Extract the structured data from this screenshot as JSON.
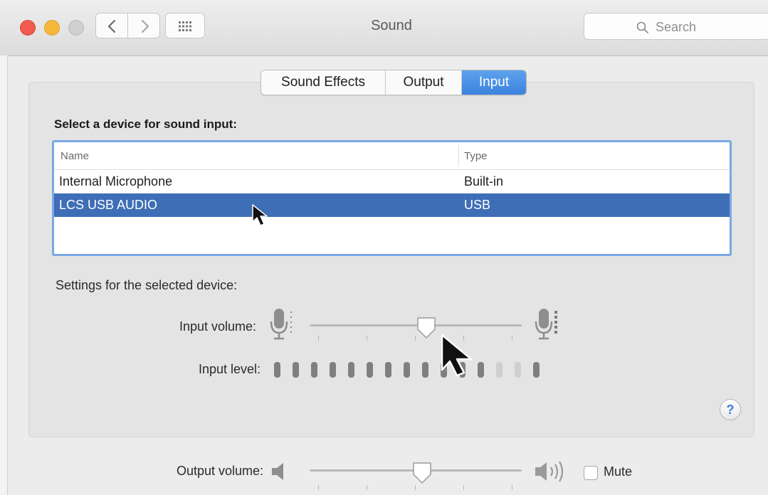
{
  "window": {
    "title": "Sound",
    "search_placeholder": "Search"
  },
  "tabs": [
    {
      "label": "Sound Effects",
      "selected": false
    },
    {
      "label": "Output",
      "selected": false
    },
    {
      "label": "Input",
      "selected": true
    }
  ],
  "input_panel": {
    "heading": "Select a device for sound input:",
    "columns": [
      "Name",
      "Type"
    ],
    "devices": [
      {
        "name": "Internal Microphone",
        "type": "Built-in",
        "selected": false
      },
      {
        "name": "LCS USB AUDIO",
        "type": "USB",
        "selected": true
      }
    ],
    "settings_heading": "Settings for the selected device:",
    "input_volume_label": "Input volume:",
    "input_volume_fraction": 0.55,
    "input_level_label": "Input level:",
    "input_level_segments_total": 15,
    "input_level_segments_lit": 12
  },
  "output": {
    "volume_label": "Output volume:",
    "volume_fraction": 0.53,
    "mute_label": "Mute",
    "muted": false
  },
  "colors": {
    "selection": "#3e6eb6",
    "tab_selected": "#4a8fe6",
    "focus_ring": "#7aa8e4",
    "help_accent": "#3d7be0"
  },
  "icons": {
    "back": "chevron-left-icon",
    "forward": "chevron-right-icon",
    "grid": "grid-icon",
    "search": "magnifier-icon",
    "mic_low": "microphone-icon",
    "mic_high": "microphone-icon",
    "speaker_low": "speaker-icon",
    "speaker_high": "speaker-loud-icon",
    "help": "question-icon"
  }
}
